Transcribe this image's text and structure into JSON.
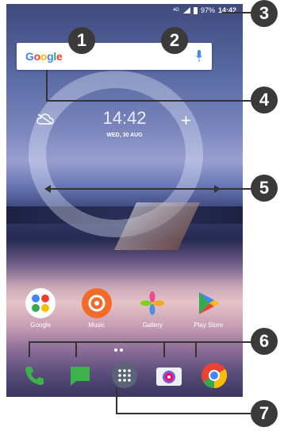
{
  "status_bar": {
    "network": "4G",
    "battery": "97%",
    "time": "14:42"
  },
  "search_bar": {
    "logo": "Google",
    "mic_icon": "microphone-icon"
  },
  "clock_widget": {
    "time": "14:42",
    "date": "WED, 30 AUG",
    "weather_icon": "cloud-off-icon",
    "add_icon": "plus-icon"
  },
  "home_apps": [
    {
      "label": "Google",
      "icon": "google-folder-icon"
    },
    {
      "label": "Music",
      "icon": "music-icon"
    },
    {
      "label": "Gallery",
      "icon": "gallery-icon"
    },
    {
      "label": "Play Store",
      "icon": "play-store-icon"
    }
  ],
  "dock_apps": [
    {
      "icon": "phone-icon"
    },
    {
      "icon": "messages-icon"
    },
    {
      "icon": "app-drawer-icon"
    },
    {
      "icon": "camera-icon"
    },
    {
      "icon": "chrome-icon"
    }
  ],
  "callouts": [
    "1",
    "2",
    "3",
    "4",
    "5",
    "6",
    "7"
  ],
  "colors": {
    "accent": "#4285F4",
    "callout_bg": "#3a3a3a"
  }
}
